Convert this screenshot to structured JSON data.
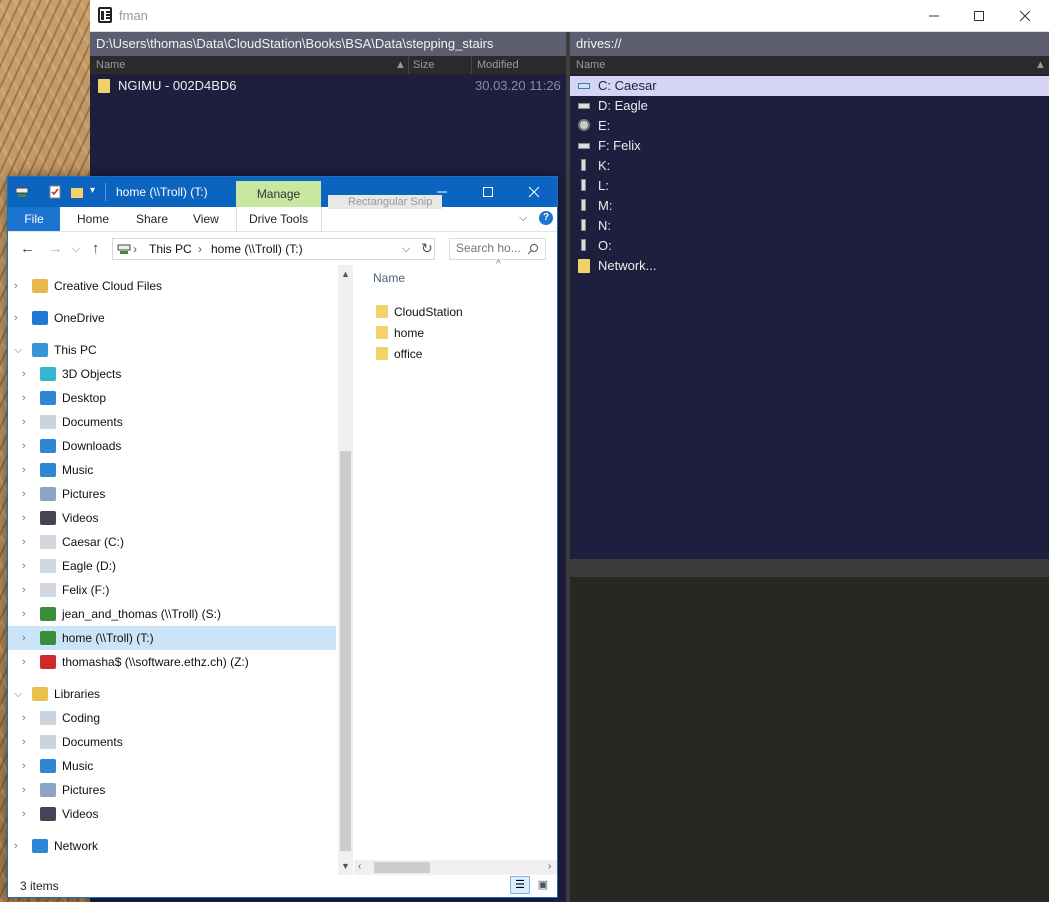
{
  "fman": {
    "title": "fman",
    "left": {
      "path": "D:\\Users\\thomas\\Data\\CloudStation\\Books\\BSA\\Data\\stepping_stairs",
      "col_name": "Name",
      "col_size": "Size",
      "col_modified": "Modified",
      "rows": [
        {
          "name": "NGIMU - 002D4BD6",
          "modified": "30.03.20 11:26"
        }
      ]
    },
    "right": {
      "path": "drives://",
      "col_name": "Name",
      "rows": [
        {
          "name": "C: Caesar",
          "icon": "system-drive-icon"
        },
        {
          "name": "D: Eagle",
          "icon": "drive-icon"
        },
        {
          "name": "E:",
          "icon": "cd-drive-icon"
        },
        {
          "name": "F: Felix",
          "icon": "drive-icon"
        },
        {
          "name": "K:",
          "icon": "usb-drive-icon"
        },
        {
          "name": "L:",
          "icon": "usb-drive-icon"
        },
        {
          "name": "M:",
          "icon": "usb-drive-icon"
        },
        {
          "name": "N:",
          "icon": "usb-drive-icon"
        },
        {
          "name": "O:",
          "icon": "usb-drive-icon"
        },
        {
          "name": "Network...",
          "icon": "folder-icon"
        }
      ]
    },
    "colors": {
      "pane_bg": "#1e1f3e",
      "selection": "#d5d4f5",
      "path_bar": "#5c5e70",
      "lower_bg": "#272822"
    }
  },
  "explorer": {
    "title": "home (\\\\Troll) (T:)",
    "manage": "Manage",
    "tabs": [
      "File",
      "Home",
      "Share",
      "View",
      "Drive Tools"
    ],
    "ghost_text": "Rectangular Snip",
    "breadcrumb": [
      "This PC",
      "home (\\\\Troll) (T:)"
    ],
    "search_placeholder": "Search ho...",
    "tree": [
      {
        "label": "Creative Cloud Files",
        "icon": "creative-cloud-icon"
      },
      {
        "label": "OneDrive",
        "icon": "onedrive-icon"
      },
      {
        "label": "This PC",
        "icon": "computer-icon"
      },
      {
        "label": "3D Objects",
        "icon": "3d-objects-icon"
      },
      {
        "label": "Desktop",
        "icon": "desktop-icon"
      },
      {
        "label": "Documents",
        "icon": "documents-icon"
      },
      {
        "label": "Downloads",
        "icon": "downloads-icon"
      },
      {
        "label": "Music",
        "icon": "music-icon"
      },
      {
        "label": "Pictures",
        "icon": "pictures-icon"
      },
      {
        "label": "Videos",
        "icon": "videos-icon"
      },
      {
        "label": "Caesar (C:)",
        "icon": "system-drive-icon"
      },
      {
        "label": "Eagle (D:)",
        "icon": "drive-icon"
      },
      {
        "label": "Felix (F:)",
        "icon": "drive-icon"
      },
      {
        "label": "jean_and_thomas (\\\\Troll) (S:)",
        "icon": "network-drive-icon"
      },
      {
        "label": "home (\\\\Troll) (T:)",
        "icon": "network-drive-icon"
      },
      {
        "label": "thomasha$ (\\\\software.ethz.ch) (Z:)",
        "icon": "disconnected-drive-icon"
      },
      {
        "label": "Libraries",
        "icon": "libraries-icon"
      },
      {
        "label": "Coding",
        "icon": "library-icon"
      },
      {
        "label": "Documents",
        "icon": "documents-icon"
      },
      {
        "label": "Music",
        "icon": "music-icon"
      },
      {
        "label": "Pictures",
        "icon": "pictures-icon"
      },
      {
        "label": "Videos",
        "icon": "videos-icon"
      },
      {
        "label": "Network",
        "icon": "network-icon"
      }
    ],
    "content_header": "Name",
    "items": [
      "CloudStation",
      "home",
      "office"
    ],
    "status": "3 items",
    "colors": {
      "title_bar": "#0a64c0",
      "manage_tab": "#c8e7a0",
      "selection": "#cce4f7"
    }
  }
}
